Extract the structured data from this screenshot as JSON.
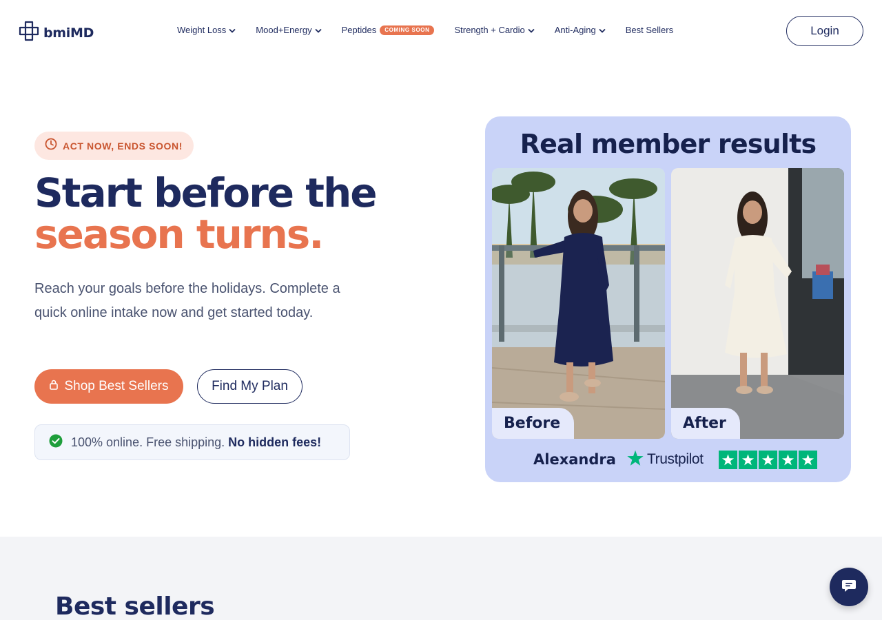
{
  "brand": {
    "name": "bmiMD"
  },
  "nav": {
    "items": [
      {
        "label": "Weight Loss",
        "has_dropdown": true
      },
      {
        "label": "Mood+Energy",
        "has_dropdown": true
      },
      {
        "label": "Peptides",
        "badge": "COMING SOON",
        "has_dropdown": false
      },
      {
        "label": "Strength + Cardio",
        "has_dropdown": true
      },
      {
        "label": "Anti-Aging",
        "has_dropdown": true
      },
      {
        "label": "Best Sellers",
        "has_dropdown": false
      }
    ],
    "login_label": "Login"
  },
  "hero": {
    "urgency": "ACT NOW, ENDS SOON!",
    "headline_line1": "Start before the",
    "headline_line2": "season turns.",
    "subtext": "Reach your goals before the holidays. Complete a quick online intake now and get started today.",
    "primary_cta": "Shop Best Sellers",
    "secondary_cta": "Find My Plan",
    "note_text": "100% online. Free shipping.",
    "note_bold": "No hidden fees!"
  },
  "results_card": {
    "title": "Real member results",
    "before_label": "Before",
    "after_label": "After",
    "reviewer": "Alexandra",
    "review_platform": "Trustpilot",
    "rating": 5
  },
  "best_sellers": {
    "title": "Best sellers"
  },
  "colors": {
    "navy": "#1e2a5e",
    "accent": "#e8744f",
    "card_bg": "#c9d3f8",
    "trustpilot": "#00b67a",
    "check_green": "#1e9e3b"
  },
  "icons": {
    "logo": "cross-logo-icon",
    "urgency": "clock-icon",
    "shop_cta": "lock-icon",
    "note": "check-circle-icon",
    "chat": "chat-bubble-icon",
    "trustpilot": "star-icon"
  }
}
